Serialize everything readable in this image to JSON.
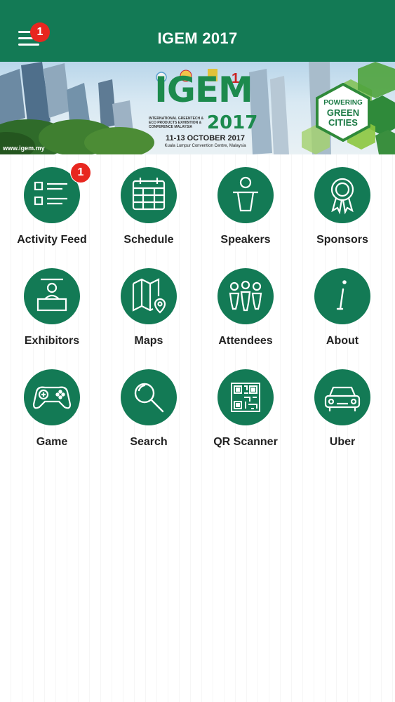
{
  "header": {
    "title": "IGEM 2017",
    "menu_badge": "1"
  },
  "banner": {
    "url": "www.igem.my",
    "logo": "IGEM",
    "year": "2017",
    "subtitle": "INTERNATIONAL GREENTECH & ECO PRODUCTS EXHIBITION & CONFERENCE MALAYSIA",
    "dates": "11-13 OCTOBER 2017",
    "venue": "Kuala Lumpur Convention Centre, Malaysia",
    "tagline": [
      "POWERING",
      "GREEN",
      "CITIES"
    ]
  },
  "tiles": [
    {
      "label": "Activity Feed",
      "icon": "list-icon",
      "badge": "1"
    },
    {
      "label": "Schedule",
      "icon": "calendar-icon"
    },
    {
      "label": "Speakers",
      "icon": "speaker-podium-icon"
    },
    {
      "label": "Sponsors",
      "icon": "award-ribbon-icon"
    },
    {
      "label": "Exhibitors",
      "icon": "exhibitor-booth-icon"
    },
    {
      "label": "Maps",
      "icon": "map-pin-icon"
    },
    {
      "label": "Attendees",
      "icon": "people-group-icon"
    },
    {
      "label": "About",
      "icon": "info-icon"
    },
    {
      "label": "Game",
      "icon": "gamepad-icon"
    },
    {
      "label": "Search",
      "icon": "magnifier-icon"
    },
    {
      "label": "QR Scanner",
      "icon": "qr-code-icon"
    },
    {
      "label": "Uber",
      "icon": "car-icon"
    }
  ],
  "colors": {
    "primary": "#137a55",
    "badge": "#e8261f",
    "brand_green": "#1c8a4d"
  }
}
